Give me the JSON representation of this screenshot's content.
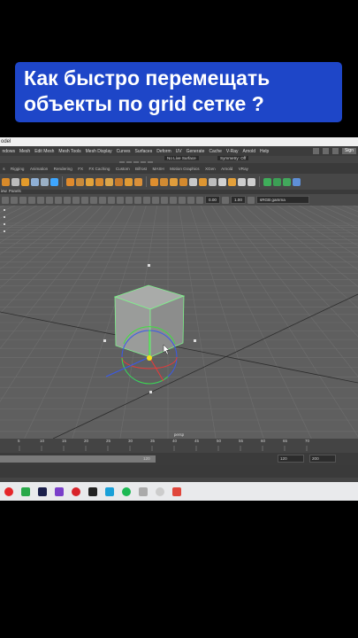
{
  "caption": {
    "line1": "Как быстро перемещать",
    "line2": "объекты по grid сетке ?"
  },
  "window": {
    "title": "odel"
  },
  "menubar": {
    "items": [
      "ndows",
      "Mesh",
      "Edit Mesh",
      "Mesh Tools",
      "Mesh Display",
      "Curves",
      "Surfaces",
      "Deform",
      "UV",
      "Generate",
      "Cache",
      "V-Ray",
      "Arnold",
      "Help"
    ],
    "live_surface": "No Live Surface",
    "symmetry": "Symmetry: Off",
    "sign_in": "Sign"
  },
  "shelf_tabs": {
    "items": [
      "s",
      "Rigging",
      "Animation",
      "Rendering",
      "FX",
      "FX Caching",
      "Custom",
      "Bifrost",
      "MASH",
      "Motion Graphics",
      "XGen",
      "Arnold",
      "VRay"
    ]
  },
  "panel_menu": {
    "items": [
      "iew",
      "Panels"
    ]
  },
  "view_toolbar": {
    "exposure": "0.00",
    "gamma": "1.00",
    "color_space": "sRGB gamma"
  },
  "viewport": {
    "camera_label": "persp"
  },
  "timeline": {
    "ticks": [
      "5",
      "10",
      "15",
      "20",
      "25",
      "30",
      "35",
      "40",
      "45",
      "50",
      "55",
      "60",
      "65",
      "70"
    ]
  },
  "range": {
    "start_left": "",
    "current": "120",
    "end": "120",
    "max": "200"
  },
  "taskbar": {
    "apps": [
      "opera",
      "camtasia",
      "premiere",
      "purple",
      "pinterest",
      "film",
      "dark",
      "spotify",
      "gray",
      "telegram-like",
      "cam-red"
    ]
  },
  "colors": {
    "caption_bg": "#1e46c8",
    "viewport_bg": "#5f5f5f",
    "cube_outline": "#7df58a",
    "axis_x": "#e53a3a",
    "axis_y": "#3fe03f",
    "axis_z": "#3a5ae8",
    "pivot": "#f4e21a"
  }
}
